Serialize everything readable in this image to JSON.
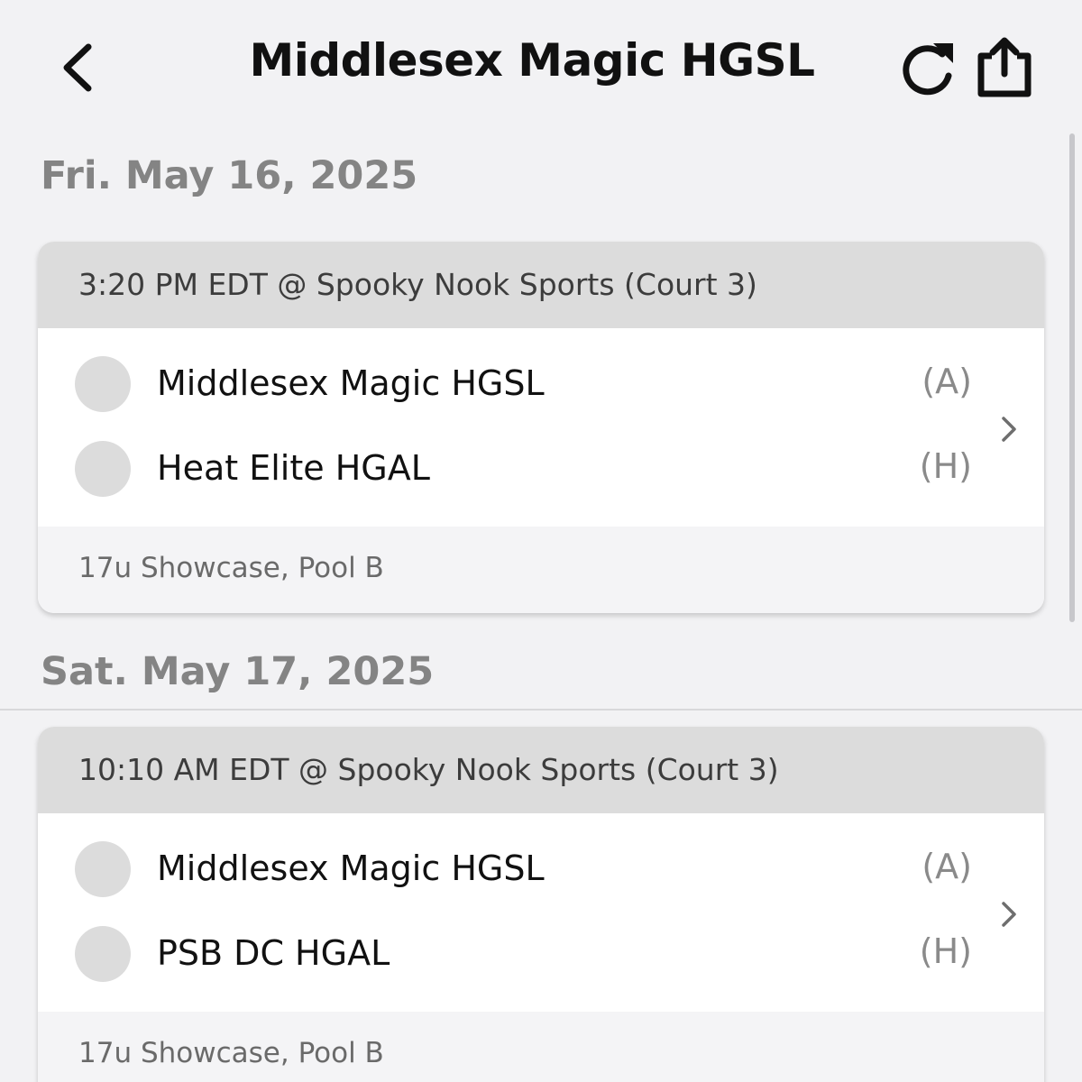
{
  "header": {
    "title": "Middlesex Magic HGSL",
    "back_icon": "chevron-left-icon",
    "refresh_icon": "refresh-icon",
    "share_icon": "share-icon"
  },
  "days": [
    {
      "date": "Fri. May 16, 2025",
      "game": {
        "time_location": "3:20 PM EDT @ Spooky Nook Sports (Court 3)",
        "teams": [
          {
            "name": "Middlesex Magic HGSL",
            "side": "(A)"
          },
          {
            "name": "Heat Elite HGAL",
            "side": "(H)"
          }
        ],
        "division": "17u Showcase, Pool B"
      }
    },
    {
      "date": "Sat. May 17, 2025",
      "game": {
        "time_location": "10:10 AM EDT @ Spooky Nook Sports (Court 3)",
        "teams": [
          {
            "name": "Middlesex Magic HGSL",
            "side": "(A)"
          },
          {
            "name": "PSB DC HGAL",
            "side": "(H)"
          }
        ],
        "division": "17u Showcase, Pool B"
      }
    }
  ],
  "colors": {
    "background": "#f2f2f4",
    "card_header": "#dcdcdc",
    "date_text": "#848484",
    "team_logo_placeholder": "#dcdcdc"
  }
}
